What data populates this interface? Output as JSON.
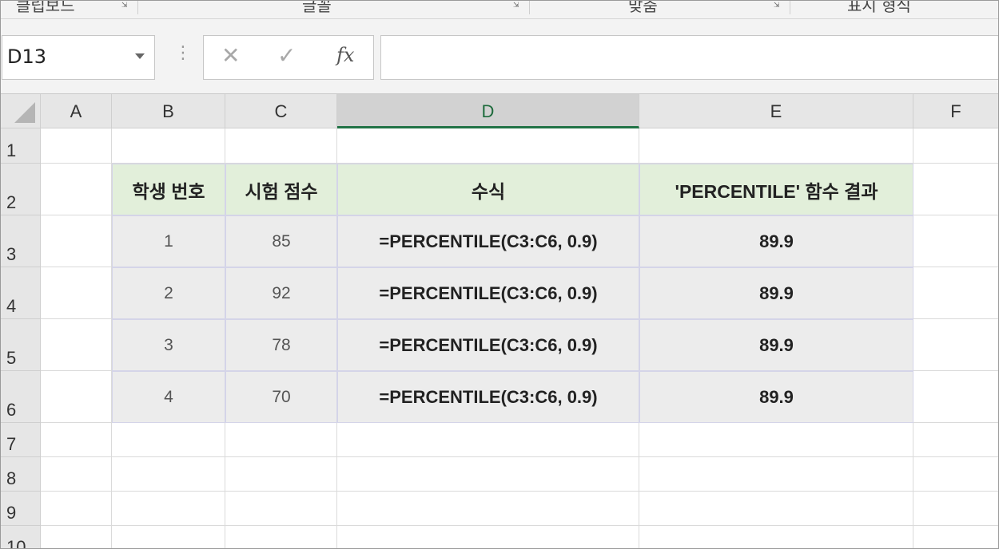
{
  "ribbon": {
    "groups": [
      "클립보드",
      "글꼴",
      "맞춤",
      "표시 형식"
    ]
  },
  "formula_bar": {
    "name_box": "D13",
    "cancel_icon": "✕",
    "enter_icon": "✓",
    "fx_label": "fx",
    "formula": ""
  },
  "sheet": {
    "columns": [
      "A",
      "B",
      "C",
      "D",
      "E",
      "F"
    ],
    "rows": [
      "1",
      "2",
      "3",
      "4",
      "5",
      "6",
      "7",
      "8",
      "9",
      "10"
    ],
    "selected_column": "D",
    "table": {
      "headers": [
        "학생 번호",
        "시험 점수",
        "수식",
        "'PERCENTILE' 함수 결과"
      ],
      "rows": [
        {
          "student": "1",
          "score": "85",
          "formula": "=PERCENTILE(C3:C6, 0.9)",
          "result": "89.9"
        },
        {
          "student": "2",
          "score": "92",
          "formula": "=PERCENTILE(C3:C6, 0.9)",
          "result": "89.9"
        },
        {
          "student": "3",
          "score": "78",
          "formula": "=PERCENTILE(C3:C6, 0.9)",
          "result": "89.9"
        },
        {
          "student": "4",
          "score": "70",
          "formula": "=PERCENTILE(C3:C6, 0.9)",
          "result": "89.9"
        }
      ]
    }
  },
  "colors": {
    "header_fill": "#e2efda",
    "data_fill": "#ececec",
    "selection_accent": "#217346"
  }
}
